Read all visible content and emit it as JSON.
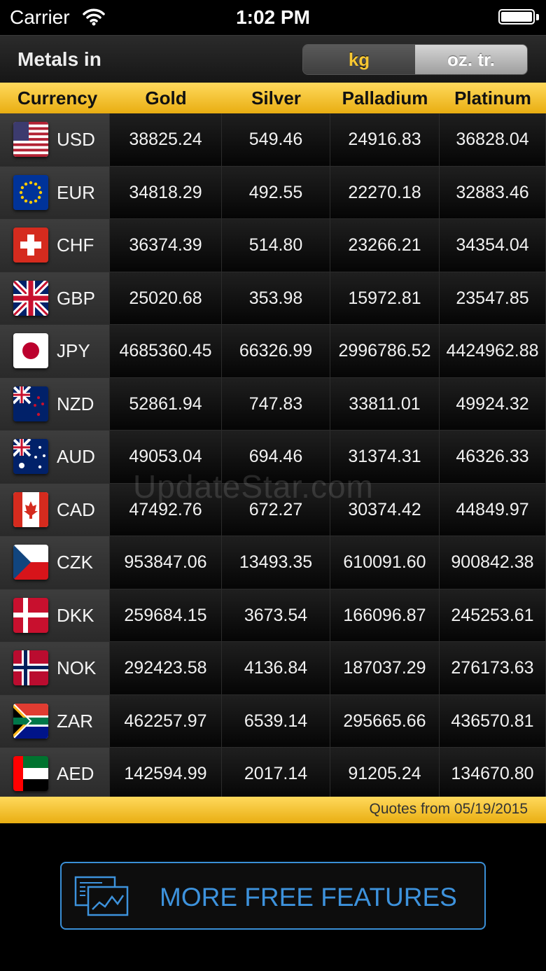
{
  "status_bar": {
    "carrier": "Carrier",
    "time": "1:02 PM"
  },
  "toolbar": {
    "title": "Metals in",
    "units": [
      {
        "label": "kg",
        "selected": true
      },
      {
        "label": "oz. tr.",
        "selected": false
      }
    ]
  },
  "table": {
    "headers": [
      "Currency",
      "Gold",
      "Silver",
      "Palladium",
      "Platinum"
    ],
    "rows": [
      {
        "code": "USD",
        "flag": "usa-flag-icon",
        "gold": "38825.24",
        "silver": "549.46",
        "palladium": "24916.83",
        "platinum": "36828.04"
      },
      {
        "code": "EUR",
        "flag": "eu-flag-icon",
        "gold": "34818.29",
        "silver": "492.55",
        "palladium": "22270.18",
        "platinum": "32883.46"
      },
      {
        "code": "CHF",
        "flag": "switzerland-flag-icon",
        "gold": "36374.39",
        "silver": "514.80",
        "palladium": "23266.21",
        "platinum": "34354.04"
      },
      {
        "code": "GBP",
        "flag": "uk-flag-icon",
        "gold": "25020.68",
        "silver": "353.98",
        "palladium": "15972.81",
        "platinum": "23547.85"
      },
      {
        "code": "JPY",
        "flag": "japan-flag-icon",
        "gold": "4685360.45",
        "silver": "66326.99",
        "palladium": "2996786.52",
        "platinum": "4424962.88"
      },
      {
        "code": "NZD",
        "flag": "new-zealand-flag-icon",
        "gold": "52861.94",
        "silver": "747.83",
        "palladium": "33811.01",
        "platinum": "49924.32"
      },
      {
        "code": "AUD",
        "flag": "australia-flag-icon",
        "gold": "49053.04",
        "silver": "694.46",
        "palladium": "31374.31",
        "platinum": "46326.33"
      },
      {
        "code": "CAD",
        "flag": "canada-flag-icon",
        "gold": "47492.76",
        "silver": "672.27",
        "palladium": "30374.42",
        "platinum": "44849.97"
      },
      {
        "code": "CZK",
        "flag": "czech-flag-icon",
        "gold": "953847.06",
        "silver": "13493.35",
        "palladium": "610091.60",
        "platinum": "900842.38"
      },
      {
        "code": "DKK",
        "flag": "denmark-flag-icon",
        "gold": "259684.15",
        "silver": "3673.54",
        "palladium": "166096.87",
        "platinum": "245253.61"
      },
      {
        "code": "NOK",
        "flag": "norway-flag-icon",
        "gold": "292423.58",
        "silver": "4136.84",
        "palladium": "187037.29",
        "platinum": "276173.63"
      },
      {
        "code": "ZAR",
        "flag": "south-africa-flag-icon",
        "gold": "462257.97",
        "silver": "6539.14",
        "palladium": "295665.66",
        "platinum": "436570.81"
      },
      {
        "code": "AED",
        "flag": "uae-flag-icon",
        "gold": "142594.99",
        "silver": "2017.14",
        "palladium": "91205.24",
        "platinum": "134670.80"
      }
    ]
  },
  "footer": {
    "quotes_text": "Quotes from 05/19/2015"
  },
  "watermark": "UpdateStar.com",
  "cta": {
    "label": "MORE FREE FEATURES",
    "icon": "chart-window-icon"
  },
  "colors": {
    "accent_gold": "#f7c733",
    "cta_blue": "#3d92dc"
  }
}
